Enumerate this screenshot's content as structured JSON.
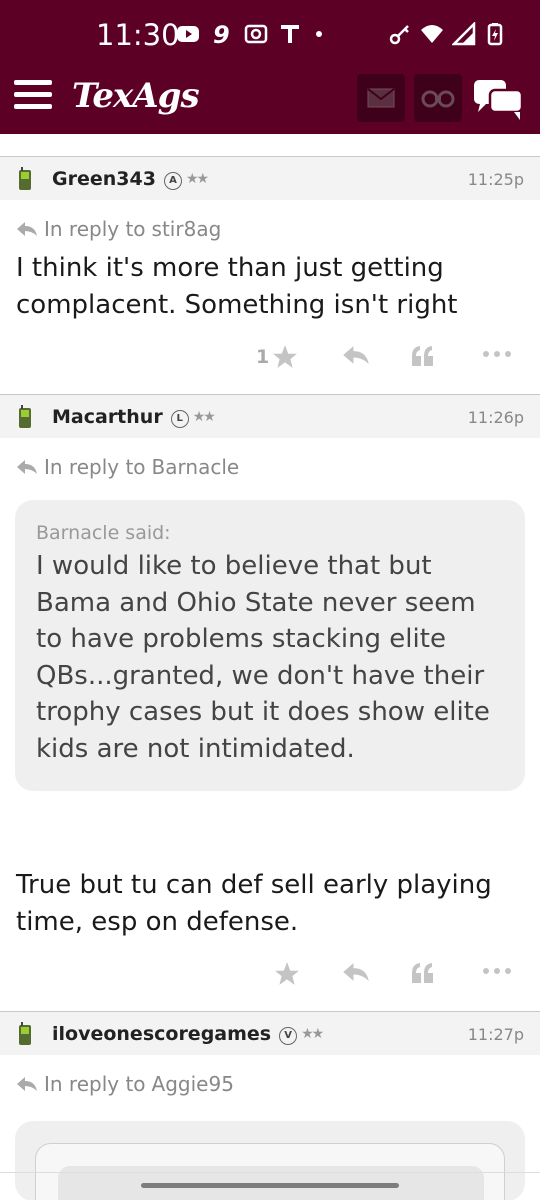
{
  "status_bar": {
    "time": "11:30",
    "icons_left": [
      "youtube-icon",
      "nine-app-icon",
      "camera-icon",
      "t-app-icon",
      "dot-icon"
    ],
    "icons_right": [
      "vpn-key-icon",
      "wifi-icon",
      "signal-icon",
      "battery-charging-icon"
    ]
  },
  "header": {
    "logo": "TexAgs",
    "brand_color": "#5c0025",
    "buttons": [
      "menu-icon",
      "mail-icon",
      "binoculars-icon",
      "chat-bubbles-icon"
    ]
  },
  "posts": [
    {
      "username": "Green343",
      "badge": "A",
      "stars": "★★",
      "time": "11:25p",
      "reply_prefix": "In reply to",
      "reply_to": "stir8ag",
      "body": "I think it's more than just getting complacent. Something isn't right",
      "star_count": "1"
    },
    {
      "username": "Macarthur",
      "badge": "L",
      "stars": "★★",
      "time": "11:26p",
      "reply_prefix": "In reply to",
      "reply_to": "Barnacle",
      "quote_author": "Barnacle said:",
      "quote_text": "I would like to believe that but Bama and Ohio State never seem to have problems stacking elite QBs...granted, we don't have their trophy cases but it does show elite kids are not intimidated.",
      "body": "True but tu can def sell early playing time, esp on defense."
    },
    {
      "username": "iloveonescoregames",
      "badge": "V",
      "stars": "★★",
      "time": "11:27p",
      "reply_prefix": "In reply to",
      "reply_to": "Aggie95"
    }
  ]
}
